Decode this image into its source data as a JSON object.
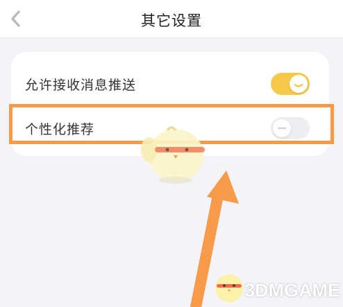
{
  "header": {
    "title": "其它设置",
    "back_icon": "chevron-left-icon"
  },
  "settings": [
    {
      "label": "允许接收消息推送",
      "enabled": true
    },
    {
      "label": "个性化推荐",
      "enabled": false
    }
  ],
  "colors": {
    "switch_on": "#f7c948",
    "switch_off": "#eceef2",
    "annotation": "#f79a4a"
  },
  "watermark": {
    "text": "3DMGAME"
  }
}
